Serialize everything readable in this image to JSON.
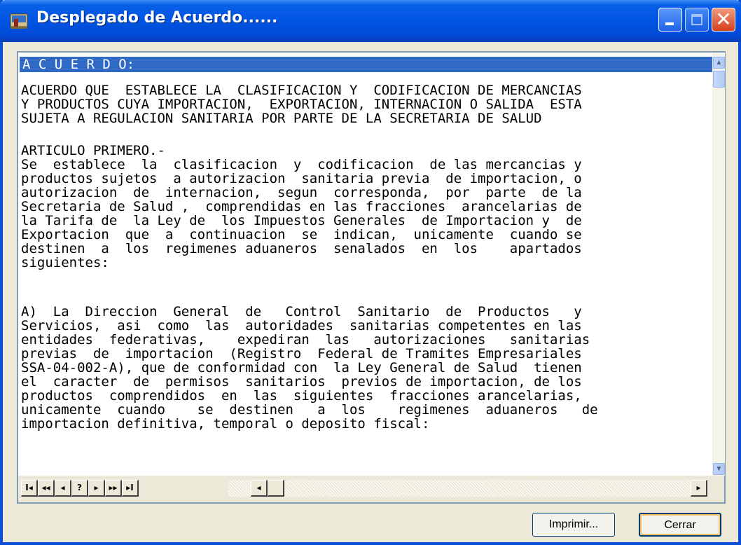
{
  "window": {
    "title": "Desplegado de Acuerdo......"
  },
  "document": {
    "heading": "A C U E R D O:",
    "paragraphs": [
      "ACUERDO QUE  ESTABLECE LA  CLASIFICACION Y  CODIFICACION DE MERCANCIAS\nY PRODUCTOS CUYA IMPORTACION,  EXPORTACION, INTERNACION O SALIDA  ESTA\nSUJETA A REGULACION SANITARIA POR PARTE DE LA SECRETARIA DE SALUD",
      "ARTICULO PRIMERO.-\nSe  establece  la  clasificacion  y  codificacion  de las mercancias y\nproductos sujetos  a autorizacion  sanitaria previa  de importacion, o\nautorizacion  de  internacion,  segun  corresponda,  por  parte  de la\nSecretaria de Salud ,  comprendidas en las fracciones  arancelarias de\nla Tarifa de  la Ley de  los Impuestos Generales  de Importacion y  de\nExportacion  que  a  continuacion  se  indican,  unicamente  cuando se\ndestinen  a  los  regimenes aduaneros  senalados  en  los    apartados\nsiguientes:",
      "A)  La  Direccion  General  de   Control  Sanitario  de  Productos   y\nServicios,  asi  como  las  autoridades  sanitarias competentes en las\nentidades  federativas,    expediran  las   autorizaciones   sanitarias\nprevias  de  importacion  (Registro  Federal de Tramites Empresariales\nSSA-04-002-A), que de conformidad con  la Ley General de Salud  tienen\nel  caracter  de  permisos  sanitarios  previos de importacion, de los\nproductos  comprendidos  en  las  siguientes  fracciones arancelarias,\nunicamente  cuando    se  destinen   a  los    regimenes  aduaneros   de\nimportacion definitiva, temporal o deposito fiscal:"
    ]
  },
  "navigator": {
    "buttons": [
      {
        "label": "I◂",
        "name": "first-page-button"
      },
      {
        "label": "◂◂",
        "name": "prev-page-button"
      },
      {
        "label": "◂",
        "name": "prev-button"
      },
      {
        "label": "?",
        "name": "help-button"
      },
      {
        "label": "▸",
        "name": "next-button"
      },
      {
        "label": "▸▸",
        "name": "next-page-button"
      },
      {
        "label": "▸I",
        "name": "last-page-button"
      }
    ]
  },
  "buttons": {
    "print": "Imprimir...",
    "close": "Cerrar"
  },
  "colors": {
    "titlebar": "#0054e3",
    "selection": "#316ac5",
    "dialog_bg": "#ece9d8"
  }
}
